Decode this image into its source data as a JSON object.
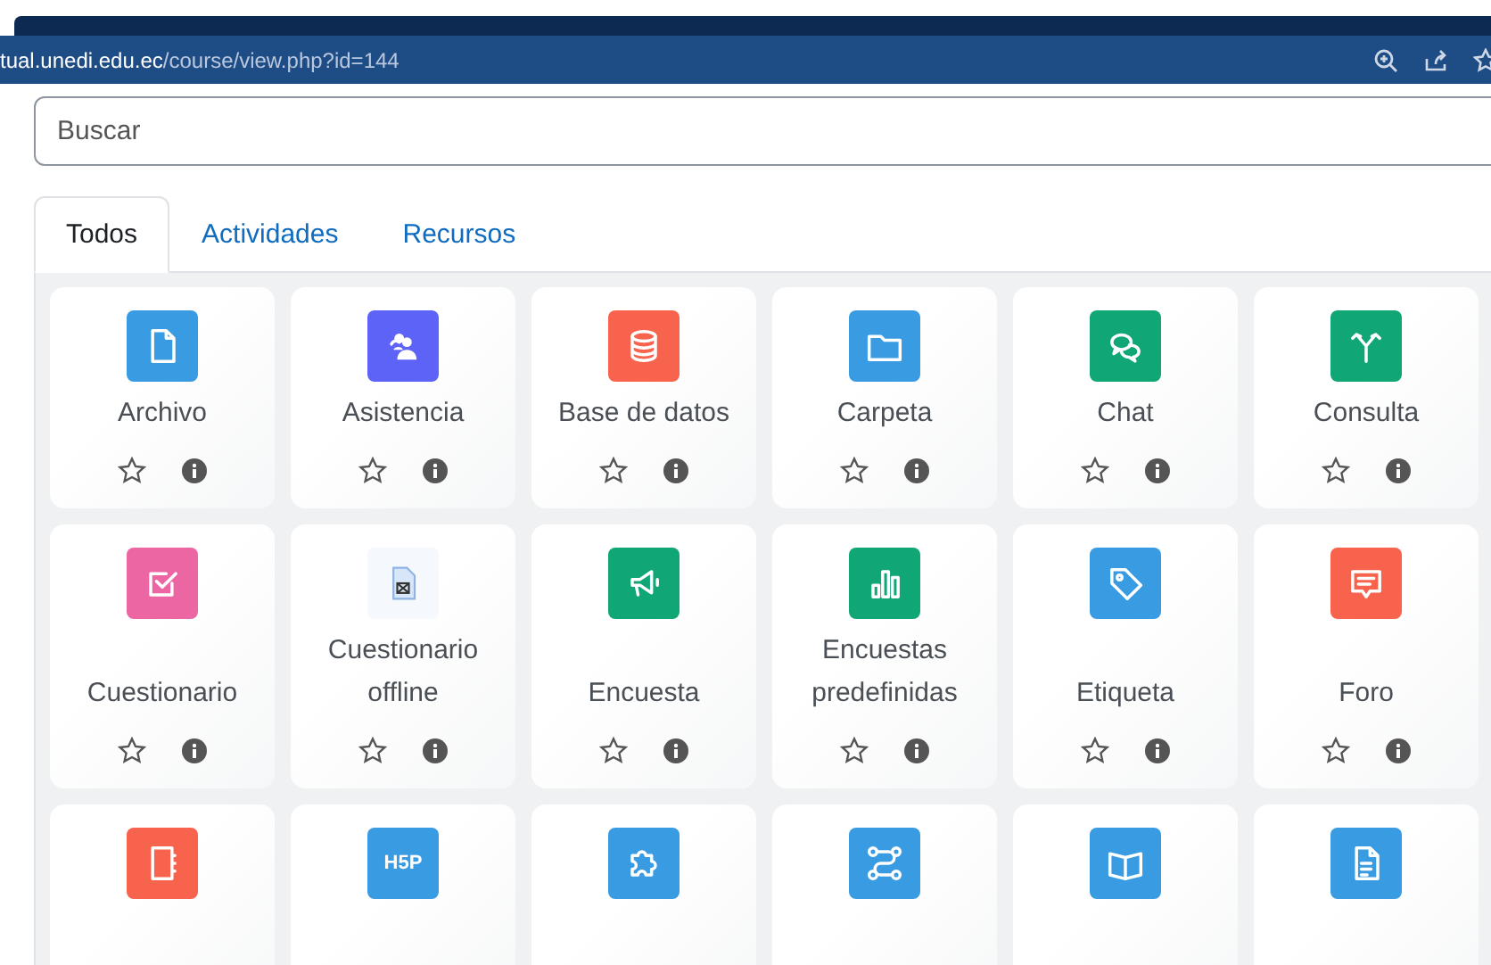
{
  "browser": {
    "url_host": "tual.unedi.edu.ec",
    "url_path": "/course/view.php?id=144"
  },
  "search": {
    "placeholder": "Buscar"
  },
  "tabs": [
    {
      "label": "Todos",
      "selected": true
    },
    {
      "label": "Actividades",
      "selected": false
    },
    {
      "label": "Recursos",
      "selected": false
    }
  ],
  "modules": [
    {
      "name": "Archivo",
      "kind": "file",
      "color": "#399be2"
    },
    {
      "name": "Asistencia",
      "kind": "people",
      "color": "#5d63f6"
    },
    {
      "name": "Base de datos",
      "kind": "database",
      "color": "#f7634d"
    },
    {
      "name": "Carpeta",
      "kind": "folder",
      "color": "#399be2"
    },
    {
      "name": "Chat",
      "kind": "chat",
      "color": "#11a676"
    },
    {
      "name": "Consulta",
      "kind": "branch",
      "color": "#11a676"
    },
    {
      "name": "Cuestionario",
      "kind": "checkbox",
      "color": "#eb66a2"
    },
    {
      "name": "Cuestionario offline",
      "kind": "docx",
      "color": "#f5f8fc"
    },
    {
      "name": "Encuesta",
      "kind": "megaphone",
      "color": "#11a676"
    },
    {
      "name": "Encuestas predefinidas",
      "kind": "bars",
      "color": "#11a676"
    },
    {
      "name": "Etiqueta",
      "kind": "tag",
      "color": "#399be2"
    },
    {
      "name": "Foro",
      "kind": "comment",
      "color": "#f7634d"
    },
    {
      "kind": "notebook",
      "color": "#f7634d"
    },
    {
      "kind": "h5p",
      "icon_text": "H5P",
      "color": "#399be2"
    },
    {
      "kind": "puzzle",
      "color": "#399be2"
    },
    {
      "kind": "route",
      "color": "#399be2"
    },
    {
      "kind": "book",
      "color": "#399be2"
    },
    {
      "kind": "document",
      "color": "#399be2"
    }
  ]
}
